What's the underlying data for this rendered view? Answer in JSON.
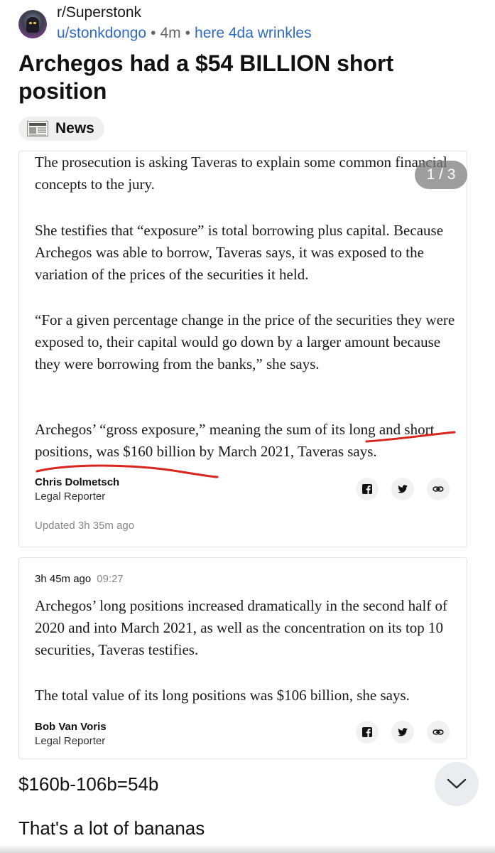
{
  "post": {
    "subreddit": "r/Superstonk",
    "author": "u/stonkdongo",
    "age": "4m",
    "user_flair": "here 4da wrinkles",
    "title": "Archegos had a $54 BILLION short position",
    "flair": "News"
  },
  "gallery": {
    "counter": "1 / 3"
  },
  "card1": {
    "paragraphs": [
      "The prosecution is asking Taveras to explain some common financial concepts to the jury.",
      "She testifies that “exposure” is total borrowing plus capital. Because Archegos was able to borrow, Taveras says, it was exposed to the variation of the prices of the securities it held.",
      "“For a given percentage change in the price of the securities they were exposed to, their capital would go down by a larger amount because they were borrowing from the banks,” she says.",
      "Archegos’ “gross exposure,” meaning the sum of its long and short positions, was $160 billion by March 2021, Taveras says."
    ],
    "author_name": "Chris Dolmetsch",
    "author_role": "Legal Reporter",
    "updated": "Updated 3h 35m ago"
  },
  "card2": {
    "time_ago": "3h 45m ago",
    "clock": "09:27",
    "paragraphs": [
      "Archegos’ long positions increased dramatically in the second half of 2020 and into March 2021, as well as the concentration on its top 10 securities, Taveras testifies.",
      "The total value of its long positions was $106 billion, she says."
    ],
    "author_name": "Bob Van Voris",
    "author_role": "Legal Reporter"
  },
  "comment": {
    "equation": "$160b-106b=54b",
    "remark": "That's a lot of bananas"
  },
  "colors": {
    "link": "#2f6bc0",
    "underline": "#d9251d",
    "flair_bg": "#efefef",
    "counter_bg": "#787878"
  },
  "icons": [
    "avatar",
    "newspaper-icon",
    "facebook-icon",
    "twitter-icon",
    "link-icon",
    "chevron-down-icon"
  ]
}
